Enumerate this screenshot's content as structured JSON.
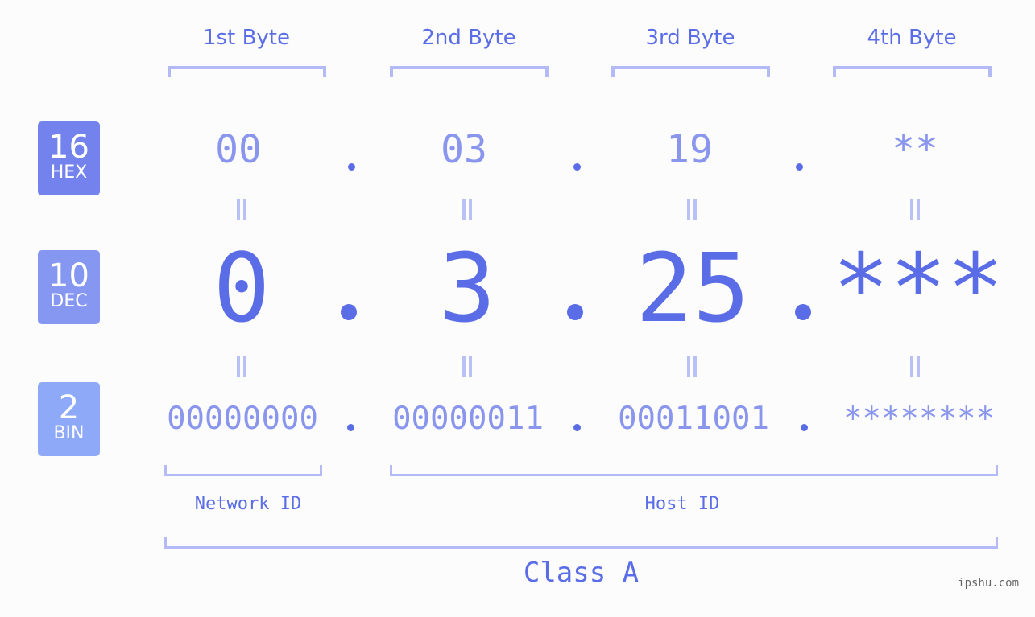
{
  "bytes": {
    "headers": [
      "1st Byte",
      "2nd Byte",
      "3rd Byte",
      "4th Byte"
    ]
  },
  "badges": {
    "hex": {
      "number": "16",
      "label": "HEX",
      "color": "#7382ec"
    },
    "dec": {
      "number": "10",
      "label": "DEC",
      "color": "#8597f1"
    },
    "bin": {
      "number": "2",
      "label": "BIN",
      "color": "#8ea9f8"
    }
  },
  "values": {
    "hex": [
      "00",
      "03",
      "19",
      "**"
    ],
    "dec": [
      "0",
      "3",
      "25",
      "***"
    ],
    "bin": [
      "00000000",
      "00000011",
      "00011001",
      "********"
    ]
  },
  "separator": ".",
  "segments": {
    "network_id": "Network ID",
    "host_id": "Host ID"
  },
  "ip_class": "Class A",
  "watermark": "ipshu.com",
  "colors": {
    "accent": "#5a6de6",
    "value_light": "#8a96ee",
    "bracket": "#b3baf7",
    "background": "#fbfcfb"
  }
}
